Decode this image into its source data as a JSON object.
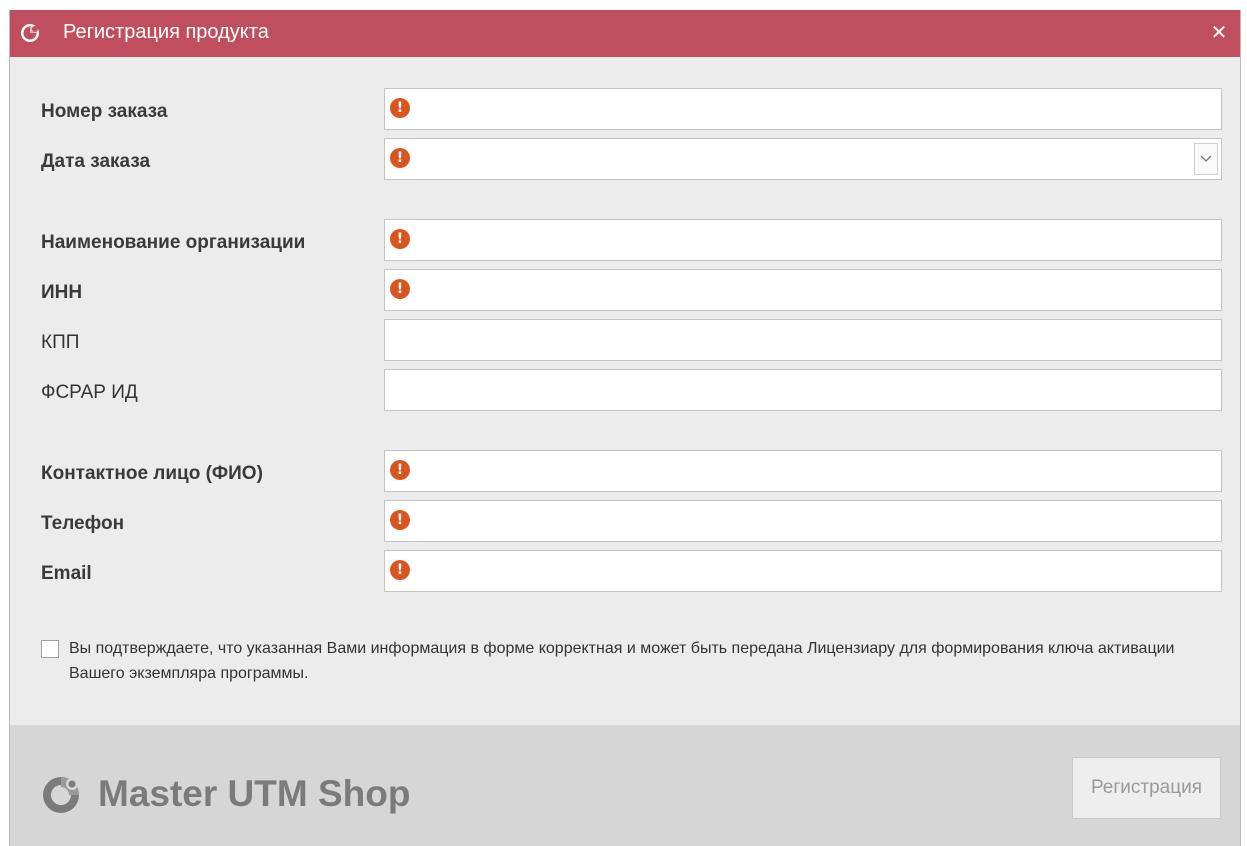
{
  "window": {
    "title": "Регистрация продукта",
    "close_glyph": "✕",
    "accent_color": "#bf4f5f"
  },
  "form": {
    "order_number": {
      "label": "Номер заказа",
      "value": "",
      "required": true
    },
    "order_date": {
      "label": "Дата заказа",
      "value": "",
      "required": true
    },
    "organization": {
      "label": "Наименование организации",
      "value": "",
      "required": true
    },
    "inn": {
      "label": "ИНН",
      "value": "",
      "required": true
    },
    "kpp": {
      "label": "КПП",
      "value": "",
      "required": false
    },
    "fsrar_id": {
      "label": "ФСРАР ИД",
      "value": "",
      "required": false
    },
    "contact_person": {
      "label": "Контактное лицо (ФИО)",
      "value": "",
      "required": true
    },
    "phone": {
      "label": "Телефон",
      "value": "",
      "required": true
    },
    "email": {
      "label": "Email",
      "value": "",
      "required": true
    },
    "warning_glyph": "!",
    "warning_icon": "exclamation-circle-icon",
    "warning_color": "#d9541e"
  },
  "consent": {
    "checked": false,
    "text": "Вы подтверждаете, что указанная Вами информация в форме корректная и может быть передана Лицензиару для формирования ключа активации Вашего экземпляра программы."
  },
  "footer": {
    "brand": "Master UTM Shop",
    "register_button": "Регистрация"
  }
}
